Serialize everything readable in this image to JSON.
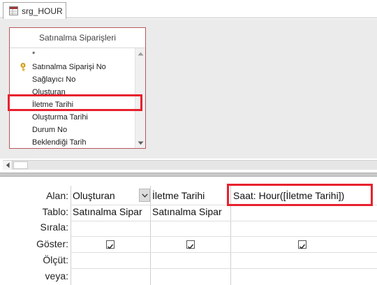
{
  "tab": {
    "label": "srg_HOUR",
    "icon": "query-icon"
  },
  "table": {
    "title": "Satınalma Siparişleri",
    "fields": [
      "*",
      "Satınalma Siparişi No",
      "Sağlayıcı No",
      "Oluşturan",
      "İletme Tarihi",
      "Oluşturma Tarihi",
      "Durum No",
      "Beklendiği Tarih"
    ],
    "primary_key_field": "Satınalma Siparişi No",
    "highlighted_field": "İletme Tarihi"
  },
  "grid": {
    "row_labels": {
      "field": "Alan:",
      "table": "Tablo:",
      "sort": "Sırala:",
      "show": "Göster:",
      "criteria": "Ölçüt:",
      "or": "veya:"
    },
    "columns": [
      {
        "field": "Oluşturan",
        "table": "Satınalma Sipar",
        "show": true
      },
      {
        "field": "İletme Tarihi",
        "table": "Satınalma Sipar",
        "show": true
      },
      {
        "field": "Saat: Hour([İletme Tarihi])",
        "table": "",
        "show": true
      }
    ]
  },
  "colors": {
    "highlight": "#e8212e",
    "table_border": "#b5595c",
    "pane_bg": "#ebebeb"
  }
}
